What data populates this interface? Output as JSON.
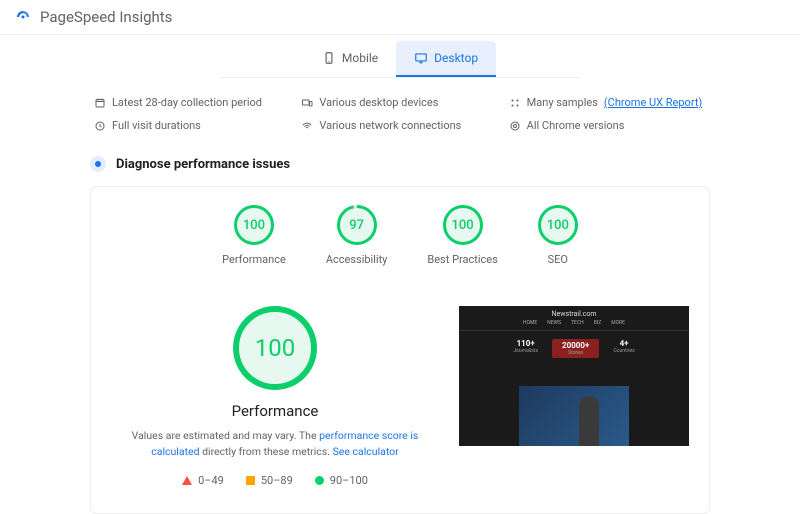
{
  "header": {
    "title": "PageSpeed Insights"
  },
  "tabs": {
    "mobile": "Mobile",
    "desktop": "Desktop"
  },
  "fields": {
    "collection": "Latest 28-day collection period",
    "devices": "Various desktop devices",
    "samples_prefix": "Many samples",
    "samples_link": "(Chrome UX Report)",
    "durations": "Full visit durations",
    "network": "Various network connections",
    "versions": "All Chrome versions"
  },
  "section": {
    "diagnose": "Diagnose performance issues"
  },
  "scores": {
    "performance": {
      "value": "100",
      "label": "Performance"
    },
    "accessibility": {
      "value": "97",
      "label": "Accessibility"
    },
    "best": {
      "value": "100",
      "label": "Best Practices"
    },
    "seo": {
      "value": "100",
      "label": "SEO"
    }
  },
  "big": {
    "value": "100",
    "title": "Performance",
    "desc1": "Values are estimated and may vary. The ",
    "desc_link1": "performance score is calculated",
    "desc2": " directly from these metrics. ",
    "desc_link2": "See calculator"
  },
  "legend": {
    "r0": "0–49",
    "r1": "50–89",
    "r2": "90–100"
  },
  "preview": {
    "site": "Newstrail.com",
    "nav": [
      "HOME",
      "NEWS",
      "TECH",
      "BIZ",
      "MORE"
    ],
    "stat1n": "110+",
    "stat1l": "Journalists",
    "stat2n": "20000+",
    "stat2l": "Stories",
    "stat3n": "4+",
    "stat3l": "Countries"
  }
}
